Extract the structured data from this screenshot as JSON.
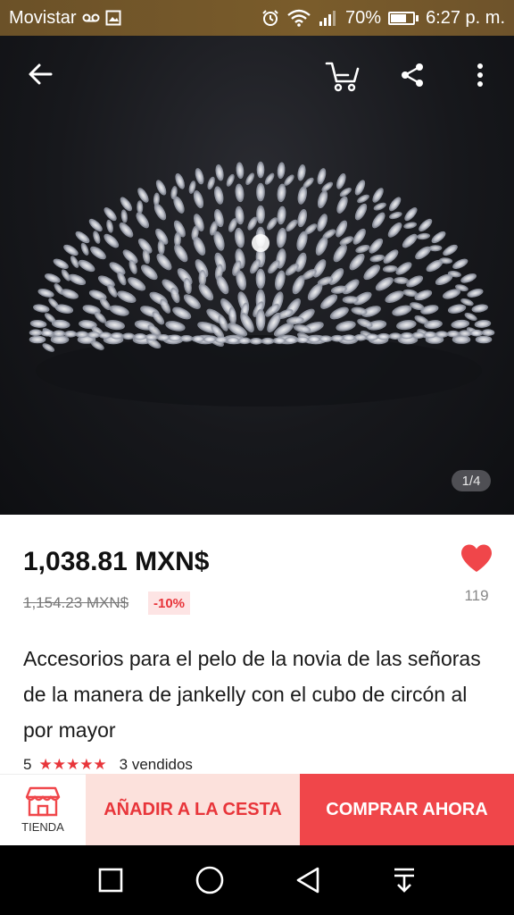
{
  "status_bar": {
    "carrier": "Movistar",
    "battery_text": "70%",
    "battery_level": 0.7,
    "time": "6:27 p. m."
  },
  "gallery": {
    "counter": "1/4"
  },
  "product": {
    "price": "1,038.81 MXN$",
    "original_price": "1,154.23 MXN$",
    "discount": "-10%",
    "wishlist_count": "119",
    "title": "Accesorios para el pelo de la novia de las señoras de la manera de jankelly con el cubo de circón al por mayor",
    "rating_value": "5",
    "stars": "★★★★★",
    "sold": "3 vendidos"
  },
  "actions": {
    "store_label": "TIENDA",
    "add_to_cart": "AÑADIR A LA CESTA",
    "buy_now": "COMPRAR AHORA"
  },
  "colors": {
    "accent": "#f0464a",
    "accent_light": "#fce1dc",
    "status_bar": "#765a2b"
  },
  "icons": [
    "back-arrow-icon",
    "cart-icon",
    "share-icon",
    "more-icon",
    "heart-icon",
    "store-icon",
    "recent-apps-icon",
    "home-icon",
    "back-icon",
    "notification-pull-icon"
  ]
}
